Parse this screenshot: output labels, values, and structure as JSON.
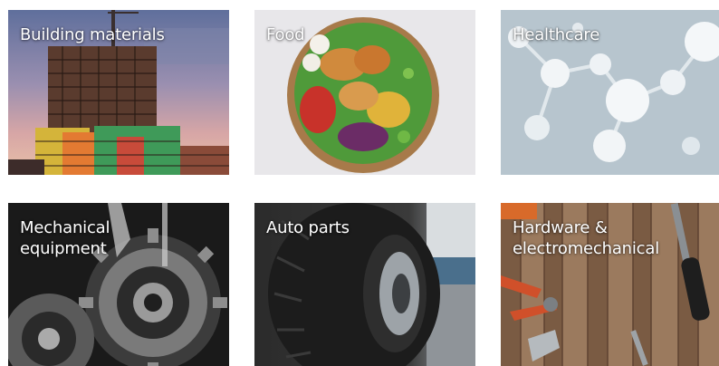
{
  "categories": [
    {
      "id": "building-materials",
      "label_lines": [
        "Building materials"
      ]
    },
    {
      "id": "food",
      "label_lines": [
        "Food"
      ]
    },
    {
      "id": "healthcare",
      "label_lines": [
        "Healthcare"
      ]
    },
    {
      "id": "mechanical-equipment",
      "label_lines": [
        "Mechanical",
        "equipment"
      ]
    },
    {
      "id": "auto-parts",
      "label_lines": [
        "Auto parts"
      ]
    },
    {
      "id": "hardware-electromechanical",
      "label_lines": [
        "Hardware &",
        "electromechanical"
      ]
    }
  ]
}
